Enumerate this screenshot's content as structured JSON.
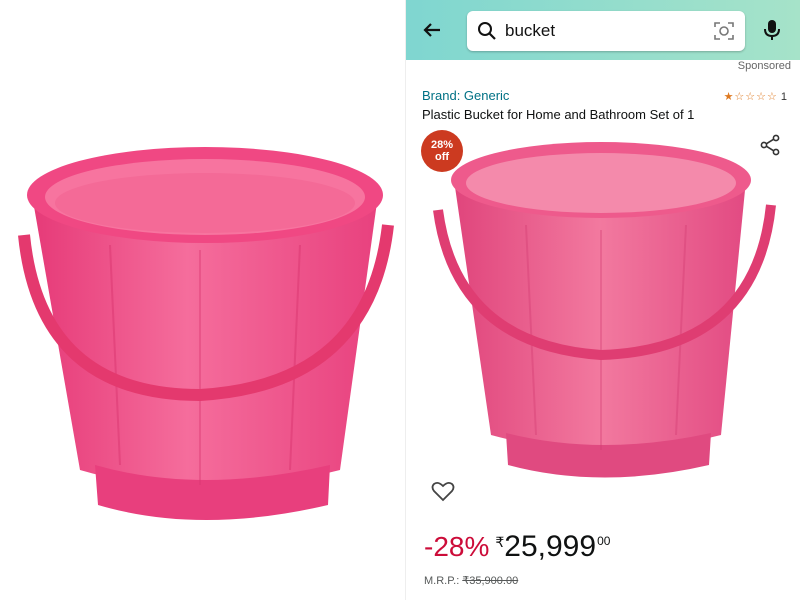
{
  "search": {
    "query": "bucket"
  },
  "sponsored_label": "Sponsored",
  "product": {
    "brand": "Brand: Generic",
    "title": "Plastic Bucket for Home and Bathroom Set of 1",
    "rating": {
      "stars": "★☆☆☆☆",
      "count": "1"
    },
    "discount_badge": {
      "line1": "28%",
      "line2": "off"
    },
    "price": {
      "discount_percent": "-28%",
      "currency": "₹",
      "amount": "25,999",
      "cents": "00",
      "mrp_label": "M.R.P.:",
      "mrp_value": "₹35,900.00"
    }
  },
  "icons": [
    "back-arrow-icon",
    "search-icon",
    "camera-lens-icon",
    "microphone-icon",
    "share-icon",
    "heart-icon"
  ],
  "colors": {
    "accent": "#007185",
    "discount": "#cc0c39",
    "badge": "#cc3a20",
    "bucket": "#f2568a",
    "header": "#8fdccd"
  }
}
